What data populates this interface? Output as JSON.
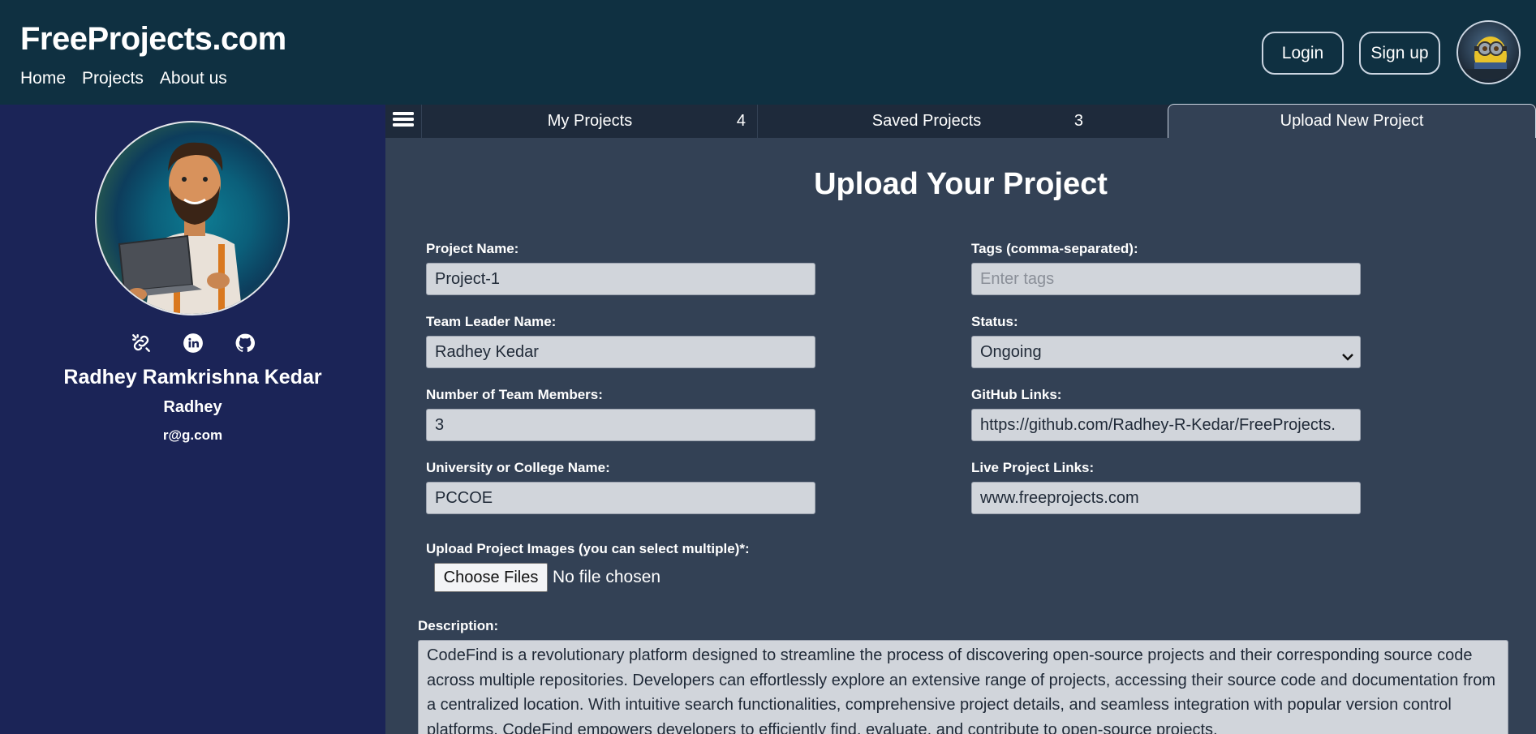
{
  "header": {
    "brand": "FreeProjects.com",
    "nav": [
      "Home",
      "Projects",
      "About us"
    ],
    "login": "Login",
    "signup": "Sign up"
  },
  "profile": {
    "name": "Radhey Ramkrishna Kedar",
    "username": "Radhey",
    "email": "r@g.com",
    "social_icons": [
      "link-icon",
      "linkedin-icon",
      "github-icon"
    ]
  },
  "tabs": [
    {
      "label": "My Projects",
      "count": "4"
    },
    {
      "label": "Saved Projects",
      "count": "3"
    },
    {
      "label": "Upload New Project",
      "count": ""
    }
  ],
  "form": {
    "title": "Upload Your Project",
    "project_name": {
      "label": "Project Name:",
      "value": "Project-1"
    },
    "team_leader": {
      "label": "Team Leader Name:",
      "value": "Radhey Kedar"
    },
    "team_members": {
      "label": "Number of Team Members:",
      "value": "3"
    },
    "university": {
      "label": "University or College Name:",
      "value": "PCCOE"
    },
    "tags": {
      "label": "Tags (comma-separated):",
      "placeholder": "Enter tags"
    },
    "status": {
      "label": "Status:",
      "value": "Ongoing"
    },
    "github": {
      "label": "GitHub Links:",
      "value": "https://github.com/Radhey-R-Kedar/FreeProjects."
    },
    "live": {
      "label": "Live Project Links:",
      "value": "www.freeprojects.com"
    },
    "images": {
      "label": "Upload Project Images (you can select multiple)*:",
      "button": "Choose Files",
      "status": "No file chosen"
    },
    "description": {
      "label": "Description:",
      "value": "CodeFind is a revolutionary platform designed to streamline the process of discovering open-source projects and their corresponding source code across multiple repositories. Developers can effortlessly explore an extensive range of projects, accessing their source code and documentation from a centralized location. With intuitive search functionalities, comprehensive project details, and seamless integration with popular version control platforms, CodeFind empowers developers to efficiently find, evaluate, and contribute to open-source projects,"
    }
  },
  "colors": {
    "header_bg": "#0f3041",
    "sidebar_bg": "#1b2457",
    "main_bg": "#334155",
    "tabs_bg": "#1e2a3b",
    "input_bg": "#d1d5db"
  }
}
